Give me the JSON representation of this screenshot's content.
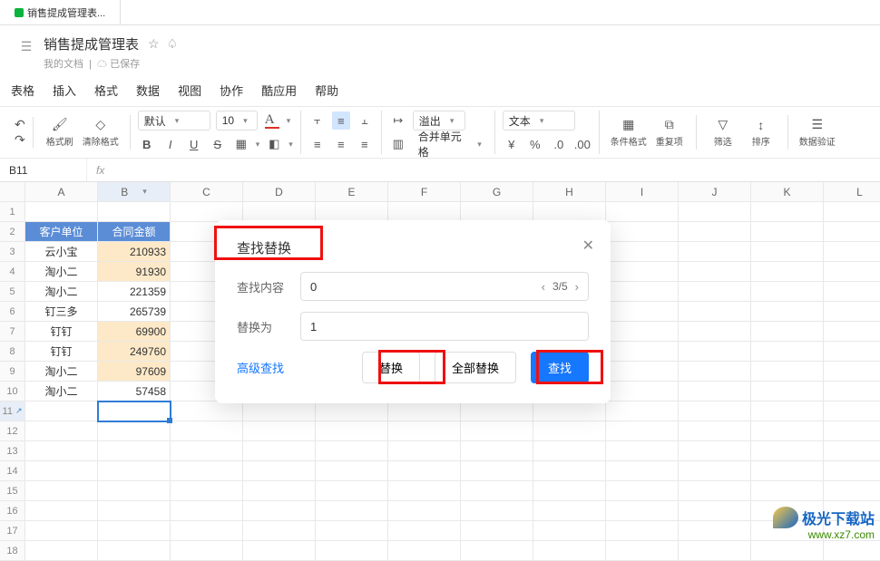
{
  "tab_title": "销售提成管理表...",
  "doc_title": "销售提成管理表",
  "doc_subtitle_left": "我的文档",
  "doc_subtitle_right": "已保存",
  "menu": [
    "表格",
    "插入",
    "格式",
    "数据",
    "视图",
    "协作",
    "酷应用",
    "帮助"
  ],
  "toolbar": {
    "format_painter": "格式刷",
    "clear_format": "清除格式",
    "font_name": "默认",
    "font_size": "10",
    "overflow_label": "溢出",
    "merge_label": "合并单元格",
    "number_format": "文本",
    "cond_format": "条件格式",
    "dup_items": "重复项",
    "filter_label": "筛选",
    "sort_label": "排序",
    "data_validate": "数据验证"
  },
  "cell_ref": "B11",
  "columns": [
    "",
    "A",
    "B",
    "C",
    "D",
    "E",
    "F",
    "G",
    "H",
    "I",
    "J",
    "K",
    "L"
  ],
  "rows": [
    {
      "num": 1
    },
    {
      "num": 2,
      "a": "客户单位",
      "b": "合同金额",
      "header": true
    },
    {
      "num": 3,
      "a": "云小宝",
      "b": "210933",
      "hlB": true
    },
    {
      "num": 4,
      "a": "淘小二",
      "b": "91930",
      "hlB": true
    },
    {
      "num": 5,
      "a": "淘小二",
      "b": "221359"
    },
    {
      "num": 6,
      "a": "钉三多",
      "b": "265739"
    },
    {
      "num": 7,
      "a": "钉钉",
      "b": "69900",
      "hlB": true
    },
    {
      "num": 8,
      "a": "钉钉",
      "b": "249760",
      "hlB": true
    },
    {
      "num": 9,
      "a": "淘小二",
      "b": "97609",
      "hlB": true
    },
    {
      "num": 10,
      "a": "淘小二",
      "b": "57458"
    },
    {
      "num": 11,
      "active": true
    },
    {
      "num": 12
    },
    {
      "num": 13
    },
    {
      "num": 14
    },
    {
      "num": 15
    },
    {
      "num": 16
    },
    {
      "num": 17
    },
    {
      "num": 18
    }
  ],
  "dialog": {
    "title": "查找替换",
    "find_label": "查找内容",
    "find_value": "0",
    "match_counter": "3/5",
    "replace_label": "替换为",
    "replace_value": "1",
    "advanced_link": "高级查找",
    "btn_replace": "替换",
    "btn_replace_all": "全部替换",
    "btn_find": "查找"
  },
  "watermark": {
    "title": "极光下载站",
    "url": "www.xz7.com"
  }
}
